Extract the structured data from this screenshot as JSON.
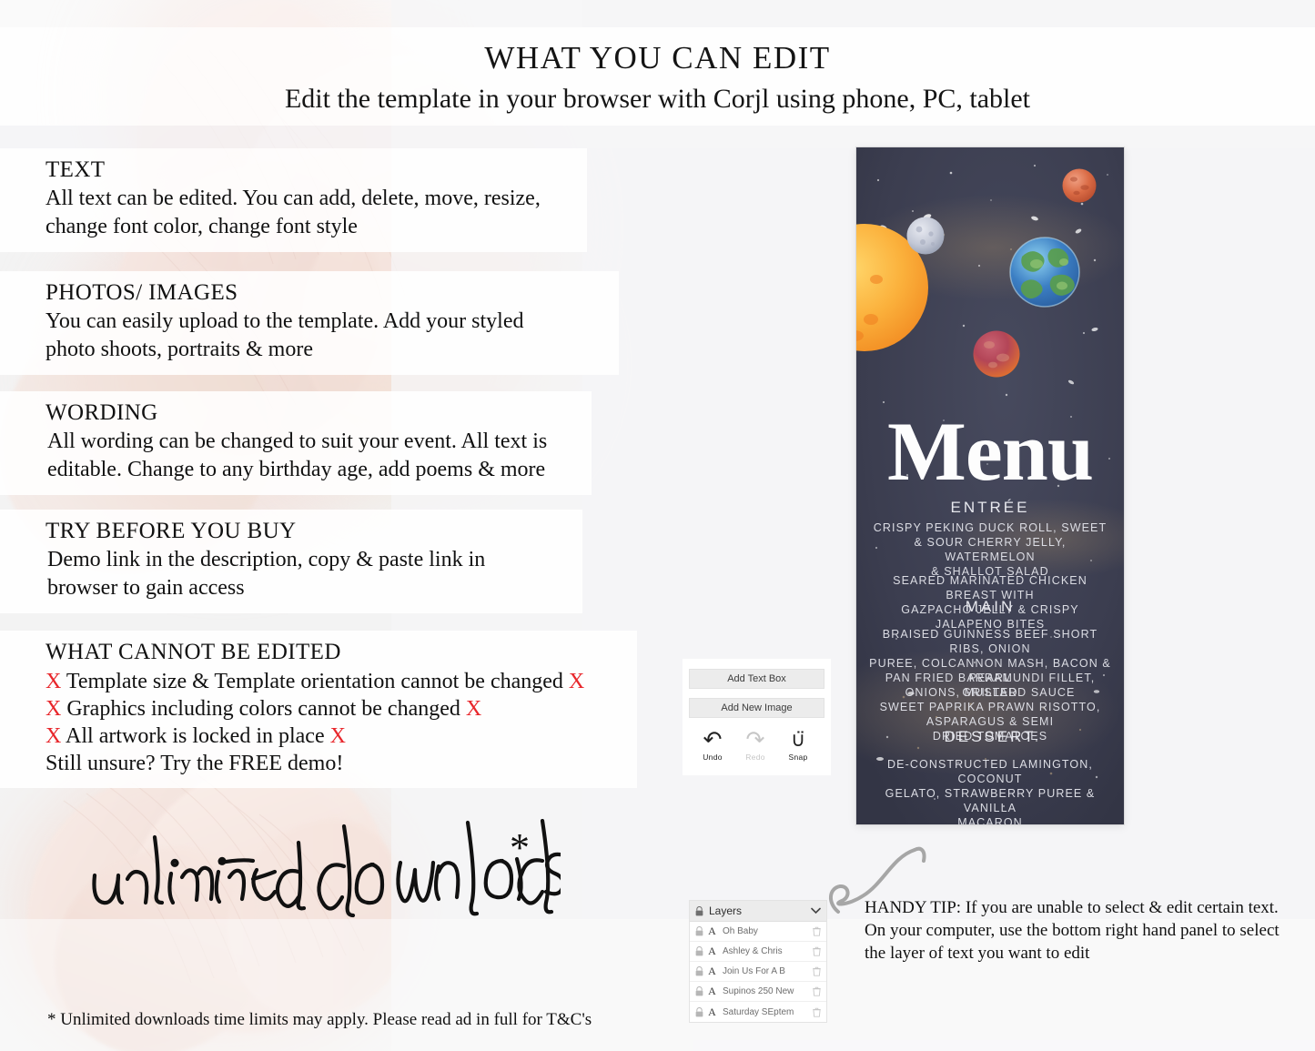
{
  "header": {
    "title": "WHAT YOU CAN EDIT",
    "subtitle": "Edit the template in your browser with Corjl using phone, PC, tablet"
  },
  "features": [
    {
      "heading": "TEXT",
      "lines": [
        "All text can be edited. You can add, delete, move, resize,",
        "change font color, change font style"
      ]
    },
    {
      "heading": "PHOTOS/ IMAGES",
      "lines": [
        "You can easily upload to the template. Add your styled",
        "photo shoots, portraits & more"
      ]
    },
    {
      "heading": "WORDING",
      "lines": [
        "All wording can be changed to suit your event. All text is",
        "editable. Change to any birthday age, add poems & more"
      ]
    },
    {
      "heading": "TRY BEFORE YOU BUY",
      "lines": [
        "Demo link in the description, copy & paste link in",
        "browser to gain access"
      ]
    }
  ],
  "cannot_edit": {
    "heading": "WHAT CANNOT BE EDITED",
    "mark": "X",
    "items": [
      "Template size & Template orientation cannot be changed",
      "Graphics including colors cannot be changed",
      "All artwork is locked in place"
    ],
    "closing": "Still unsure? Try the FREE demo!"
  },
  "script_word": {
    "text": "unlimited downloads",
    "asterisk": "*"
  },
  "footnote": "* Unlimited downloads time limits may apply. Please read ad in full for T&C's",
  "menu_card": {
    "title": "Menu",
    "sections": [
      {
        "name": "ENTRÉE",
        "items": [
          "CRISPY PEKING DUCK ROLL, SWEET\n& SOUR CHERRY JELLY, WATERMELON\n& SHALLOT SALAD",
          "SEARED MARINATED CHICKEN BREAST WITH\nGAZPACHO JELLY & CRISPY JALAPENO BITES"
        ]
      },
      {
        "name": "MAIN",
        "items": [
          "BRAISED GUINNESS BEEF SHORT RIBS, ONION\nPUREE, COLCANNON MASH, BACON & PEARL\nONIONS, MUSTARD SAUCE",
          "PAN FRIED BARRAMUNDI FILLET, GRILLED\nSWEET PAPRIKA PRAWN RISOTTO,\nASPARAGUS & SEMI\nDRIED TOMATOES"
        ]
      },
      {
        "name": "DESSERT",
        "items": [
          "DE-CONSTRUCTED LAMINGTON, COCONUT\nGELATO, STRAWBERRY PUREE & VANILLA\nMACARON"
        ]
      }
    ],
    "entree_label": "ENTRÉE",
    "main_label": "MAIN",
    "dessert_label": "DESSERT",
    "entree_1": "CRISPY PEKING DUCK ROLL, SWEET\n& SOUR CHERRY JELLY, WATERMELON\n& SHALLOT SALAD",
    "entree_2": "SEARED MARINATED CHICKEN BREAST WITH\nGAZPACHO JELLY & CRISPY JALAPENO BITES",
    "main_1": "BRAISED GUINNESS BEEF SHORT RIBS, ONION\nPUREE, COLCANNON MASH, BACON & PEARL\nONIONS, MUSTARD SAUCE",
    "main_2": "PAN FRIED BARRAMUNDI FILLET, GRILLED\nSWEET PAPRIKA PRAWN RISOTTO,\nASPARAGUS & SEMI\nDRIED TOMATOES",
    "dessert_1": "DE-CONSTRUCTED LAMINGTON, COCONUT\nGELATO, STRAWBERRY PUREE & VANILLA\nMACARON",
    "background_color": "#3b3d4f",
    "planets": [
      "sun",
      "moon",
      "mars-orange",
      "earth",
      "mars-red"
    ]
  },
  "editor": {
    "add_text_box": "Add Text Box",
    "add_new_image": "Add New Image",
    "tools": [
      {
        "label": "Undo",
        "icon": "undo-arrow-icon",
        "state": "enabled"
      },
      {
        "label": "Redo",
        "icon": "redo-arrow-icon",
        "state": "disabled"
      },
      {
        "label": "Snap",
        "icon": "magnet-icon",
        "state": "enabled"
      }
    ],
    "undo_label": "Undo",
    "redo_label": "Redo",
    "snap_label": "Snap"
  },
  "layers_panel": {
    "title": "Layers",
    "rows": [
      {
        "name": "Oh Baby"
      },
      {
        "name": "Ashley & Chris"
      },
      {
        "name": "Join Us For A B"
      },
      {
        "name": "Supinos 250 New"
      },
      {
        "name": "Saturday SEptem"
      }
    ]
  },
  "handy_tip": {
    "lines": [
      "HANDY TIP: If you are unable to select & edit certain text.",
      "On your computer, use the bottom right hand panel to select",
      "the layer of text you want to edit"
    ]
  },
  "colors": {
    "red_mark": "#e8262b",
    "card_bg": "#3b3d4f",
    "page_bg": "#f3f3f3"
  }
}
